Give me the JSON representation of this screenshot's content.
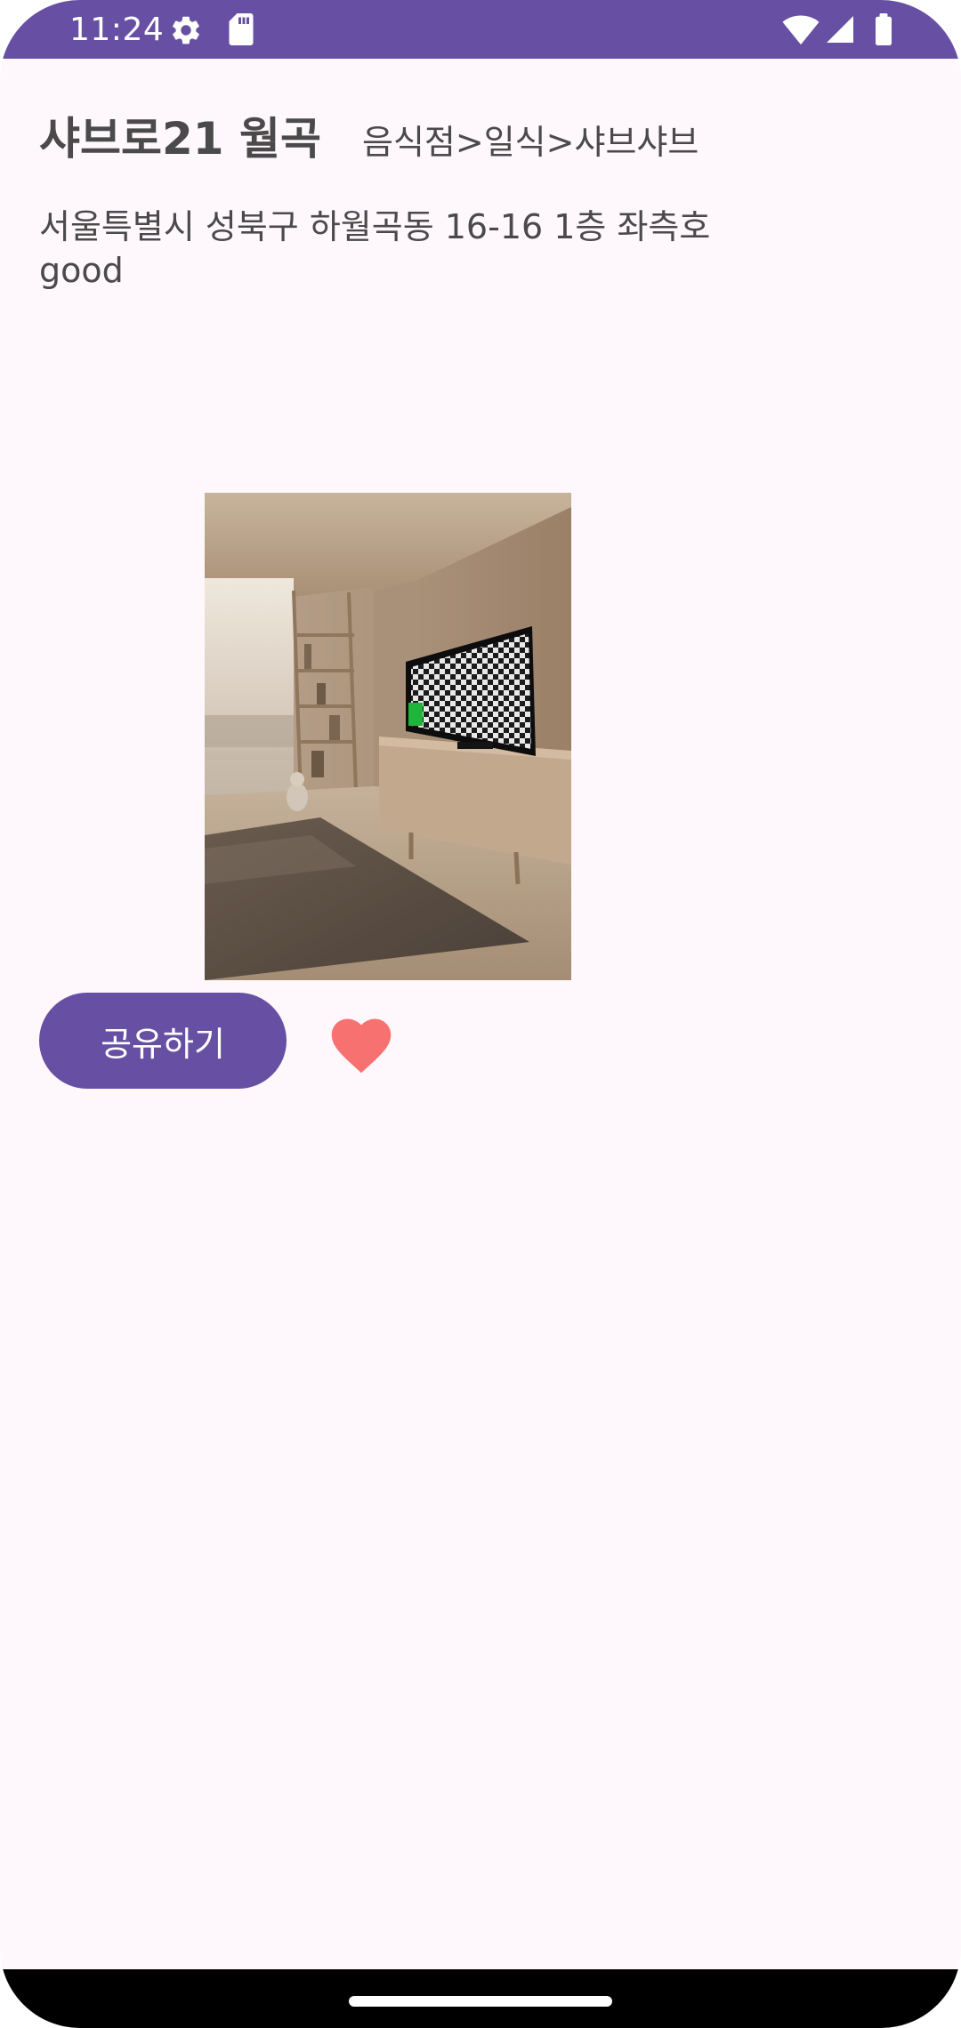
{
  "status_bar": {
    "time": "11:24",
    "icons": [
      "gear-icon",
      "sd-card-icon",
      "wifi-icon",
      "signal-icon",
      "battery-icon"
    ],
    "background": "#6750a4"
  },
  "place": {
    "name": "샤브로21 월곡",
    "category": "음식점>일식>샤브샤브",
    "address": "서울특별시 성북구 하월곡동 16-16 1층 좌측호",
    "memo": "good"
  },
  "actions": {
    "share_label": "공유하기",
    "favorite_icon": "heart-icon",
    "favorite_color": "#f87171",
    "accent": "#6750a4"
  }
}
